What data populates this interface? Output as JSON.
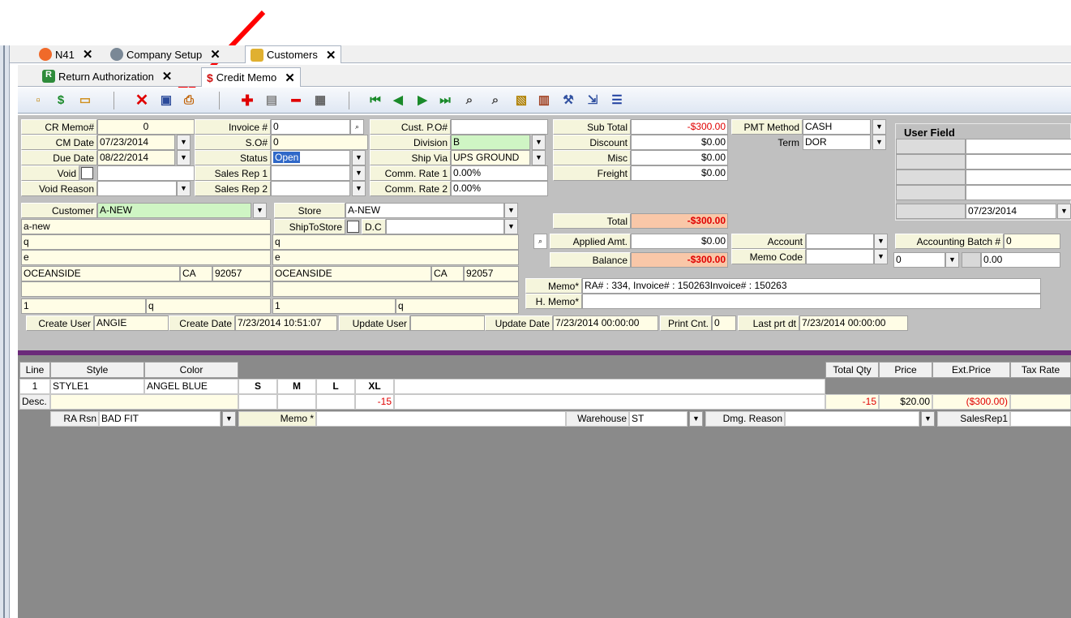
{
  "tabs_top": [
    {
      "label": "N41"
    },
    {
      "label": "Company Setup"
    },
    {
      "label": "Customers"
    }
  ],
  "tabs_second": [
    {
      "label": "Return Authorization"
    },
    {
      "label": "Credit Memo"
    }
  ],
  "header": {
    "cr_memo_label": "CR Memo#",
    "cr_memo_value": "0",
    "cm_date_label": "CM Date",
    "cm_date_value": "07/23/2014",
    "due_date_label": "Due Date",
    "due_date_value": "08/22/2014",
    "void_label": "Void",
    "void_reason_label": "Void Reason",
    "invoice_label": "Invoice #",
    "invoice_value": "0",
    "so_label": "S.O#",
    "so_value": "0",
    "status_label": "Status",
    "status_value": "Open",
    "sales_rep1_label": "Sales Rep 1",
    "sales_rep2_label": "Sales Rep 2",
    "cust_po_label": "Cust. P.O#",
    "division_label": "Division",
    "division_value": "B",
    "ship_via_label": "Ship Via",
    "ship_via_value": "UPS GROUND",
    "comm_rate1_label": "Comm. Rate 1",
    "comm_rate1_value": "0.00%",
    "comm_rate2_label": "Comm. Rate 2",
    "comm_rate2_value": "0.00%"
  },
  "customer": {
    "customer_label": "Customer",
    "customer_value": "A-NEW",
    "name": "a-new",
    "addr1": "q",
    "addr2": "e",
    "city": "OCEANSIDE",
    "state": "CA",
    "zip": "92057",
    "phone": "1",
    "fax": "q"
  },
  "store": {
    "store_label": "Store",
    "store_value": "A-NEW",
    "ship_to_store_label": "ShipToStore",
    "dc_label": "D.C",
    "addr1": "q",
    "addr2": "e",
    "city": "OCEANSIDE",
    "state": "CA",
    "zip": "92057",
    "phone": "1",
    "fax": "q"
  },
  "totals": {
    "sub_total_label": "Sub Total",
    "sub_total_value": "-$300.00",
    "discount_label": "Discount",
    "discount_value": "$0.00",
    "misc_label": "Misc",
    "misc_value": "$0.00",
    "freight_label": "Freight",
    "freight_value": "$0.00",
    "total_label": "Total",
    "total_value": "-$300.00",
    "applied_label": "Applied Amt.",
    "applied_value": "$0.00",
    "balance_label": "Balance",
    "balance_value": "-$300.00"
  },
  "payment": {
    "pmt_method_label": "PMT Method",
    "pmt_method_value": "CASH",
    "term_label": "Term",
    "term_value": "DOR",
    "account_label": "Account",
    "memo_code_label": "Memo Code",
    "accounting_batch_label": "Accounting Batch #",
    "accounting_batch_value": "0",
    "batch_sub_value": "0",
    "batch_amount_value": "0.00"
  },
  "user_field": {
    "title": "User Field",
    "date_value": "07/23/2014"
  },
  "memo": {
    "memo_label": "Memo*",
    "memo_value": "RA# : 334, Invoice# : 150263Invoice# : 150263",
    "h_memo_label": "H. Memo*",
    "h_memo_value": ""
  },
  "audit": {
    "create_user_label": "Create User",
    "create_user_value": "ANGIE",
    "create_date_label": "Create Date",
    "create_date_value": "7/23/2014 10:51:07",
    "update_user_label": "Update User",
    "update_user_value": "",
    "update_date_label": "Update Date",
    "update_date_value": "7/23/2014 00:00:00",
    "print_cnt_label": "Print Cnt.",
    "print_cnt_value": "0",
    "last_prt_label": "Last prt dt",
    "last_prt_value": "7/23/2014 00:00:00"
  },
  "grid": {
    "headers": {
      "line": "Line",
      "style": "Style",
      "color": "Color",
      "total_qty": "Total Qty",
      "price": "Price",
      "ext_price": "Ext.Price",
      "tax_rate": "Tax Rate"
    },
    "row": {
      "line": "1",
      "style": "STYLE1",
      "color": "ANGEL BLUE",
      "sizes": [
        "S",
        "M",
        "L",
        "XL"
      ]
    },
    "desc_label": "Desc.",
    "qty_xl": "-15",
    "total_qty": "-15",
    "price": "$20.00",
    "ext_price": "($300.00)",
    "ra_rsn_label": "RA Rsn",
    "ra_rsn_value": "BAD FIT",
    "line_memo_label": "Memo *",
    "warehouse_label": "Warehouse",
    "warehouse_value": "ST",
    "dmg_reason_label": "Dmg. Reason",
    "sales_rep1_label": "SalesRep1"
  },
  "colors": {
    "accent_red": "#e00000",
    "purple_bar": "#6b2a7a",
    "form_bg": "#c0c0c0"
  }
}
